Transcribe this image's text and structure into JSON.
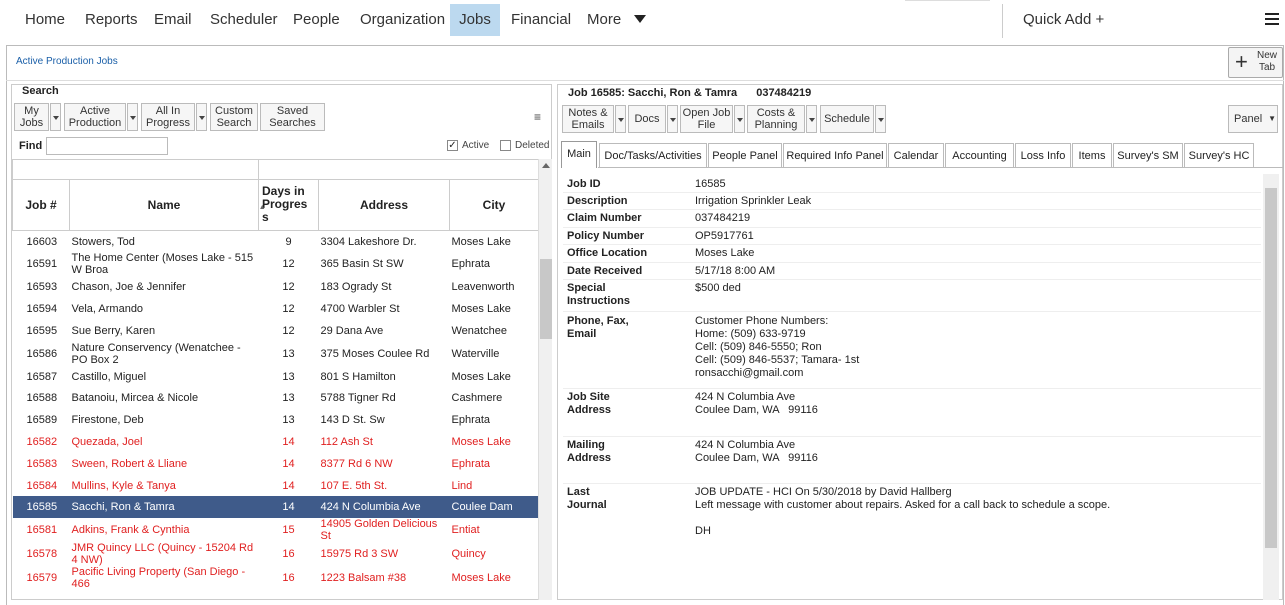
{
  "nav": {
    "items": [
      "Home",
      "Reports",
      "Email",
      "Scheduler",
      "People",
      "Organization",
      "Jobs",
      "Financial",
      "More"
    ],
    "quick_add": "Quick Add +"
  },
  "breadcrumb": "Active Production Jobs",
  "new_tab": "New\nTab",
  "search": {
    "legend": "Search",
    "buttons": [
      "My\nJobs",
      "Active\nProduction",
      "All In\nProgress",
      "Custom\nSearch",
      "Saved\nSearches"
    ],
    "find_label": "Find",
    "find_value": "",
    "active_label": "Active",
    "active_checked": true,
    "deleted_label": "Deleted",
    "deleted_checked": false
  },
  "grid": {
    "columns": [
      "Job #",
      "Name",
      "Days in\nProgres\ns",
      "Address",
      "City"
    ],
    "rows": [
      {
        "job": "16603",
        "name": "Stowers, Tod",
        "days": "9",
        "address": "3304 Lakeshore Dr.",
        "city": "Moses Lake",
        "style": "normal"
      },
      {
        "job": "16591",
        "name": "The Home Center (Moses Lake - 515 W Broa",
        "days": "12",
        "address": "365 Basin St SW",
        "city": "Ephrata",
        "style": "normal"
      },
      {
        "job": "16593",
        "name": "Chason, Joe & Jennifer",
        "days": "12",
        "address": "183 Ogrady St",
        "city": "Leavenworth",
        "style": "normal"
      },
      {
        "job": "16594",
        "name": "Vela, Armando",
        "days": "12",
        "address": "4700 Warbler St",
        "city": "Moses Lake",
        "style": "normal"
      },
      {
        "job": "16595",
        "name": "Sue Berry, Karen",
        "days": "12",
        "address": "29 Dana Ave",
        "city": "Wenatchee",
        "style": "normal"
      },
      {
        "job": "16586",
        "name": "Nature Conservency (Wenatchee - PO Box 2",
        "days": "13",
        "address": "375 Moses Coulee Rd",
        "city": "Waterville",
        "style": "normal"
      },
      {
        "job": "16587",
        "name": "Castillo, Miguel",
        "days": "13",
        "address": "801 S Hamilton",
        "city": "Moses Lake",
        "style": "normal"
      },
      {
        "job": "16588",
        "name": "Batanoiu, Mircea & Nicole",
        "days": "13",
        "address": "5788 Tigner Rd",
        "city": "Cashmere",
        "style": "normal"
      },
      {
        "job": "16589",
        "name": "Firestone, Deb",
        "days": "13",
        "address": "143 D St. Sw",
        "city": "Ephrata",
        "style": "normal"
      },
      {
        "job": "16582",
        "name": "Quezada, Joel",
        "days": "14",
        "address": "112 Ash St",
        "city": "Moses Lake",
        "style": "red"
      },
      {
        "job": "16583",
        "name": "Sween, Robert & Lliane",
        "days": "14",
        "address": "8377 Rd 6 NW",
        "city": "Ephrata",
        "style": "red"
      },
      {
        "job": "16584",
        "name": "Mullins, Kyle & Tanya",
        "days": "14",
        "address": "107 E. 5th St.",
        "city": "Lind",
        "style": "red"
      },
      {
        "job": "16585",
        "name": "Sacchi, Ron & Tamra",
        "days": "14",
        "address": "424 N Columbia Ave",
        "city": "Coulee Dam",
        "style": "selected"
      },
      {
        "job": "16581",
        "name": "Adkins, Frank & Cynthia",
        "days": "15",
        "address": "14905 Golden Delicious St",
        "city": "Entiat",
        "style": "red"
      },
      {
        "job": "16578",
        "name": "JMR Quincy LLC (Quincy - 15204 Rd 4 NW)",
        "days": "16",
        "address": "15975 Rd 3 SW",
        "city": "Quincy",
        "style": "red"
      },
      {
        "job": "16579",
        "name": "Pacific Living Property (San Diego - 466",
        "days": "16",
        "address": "1223 Balsam #38",
        "city": "Moses Lake",
        "style": "red"
      }
    ]
  },
  "job": {
    "header": "Job 16585: Sacchi, Ron & Tamra",
    "claim_header": "037484219",
    "toolbar": [
      "Notes &\nEmails",
      "Docs",
      "Open Job\nFile",
      "Costs &\nPlanning",
      "Schedule"
    ],
    "panel_label": "Panel",
    "tabs": [
      "Main",
      "Doc/Tasks/Activities",
      "People Panel",
      "Required Info Panel",
      "Calendar",
      "Accounting",
      "Loss Info",
      "Items",
      "Survey's SM",
      "Survey's HC"
    ],
    "fields": [
      {
        "label": "Job ID",
        "value": "16585"
      },
      {
        "label": "Description",
        "value": "Irrigation Sprinkler Leak"
      },
      {
        "label": "Claim Number",
        "value": "037484219"
      },
      {
        "label": "Policy Number",
        "value": "OP5917761"
      },
      {
        "label": "Office Location",
        "value": "Moses Lake"
      },
      {
        "label": "Date Received",
        "value": "5/17/18 8:00 AM"
      },
      {
        "label": "Special\nInstructions",
        "value": "$500 ded"
      },
      {
        "label": "Phone, Fax,\nEmail",
        "value": "Customer Phone Numbers:\nHome: (509) 633-9719\nCell: (509) 846-5550; Ron\nCell: (509) 846-5537; Tamara- 1st\nronsacchi@gmail.com"
      },
      {
        "label": "Job Site\nAddress",
        "value": "424 N Columbia Ave\nCoulee Dam, WA   99116"
      },
      {
        "label": "Mailing\nAddress",
        "value": "424 N Columbia Ave\nCoulee Dam, WA   99116"
      },
      {
        "label": "Last\nJournal",
        "value": "JOB UPDATE - HCI On 5/30/2018 by David Hallberg\nLeft message with customer about repairs. Asked for a call back to schedule a scope.\n\nDH"
      }
    ]
  }
}
